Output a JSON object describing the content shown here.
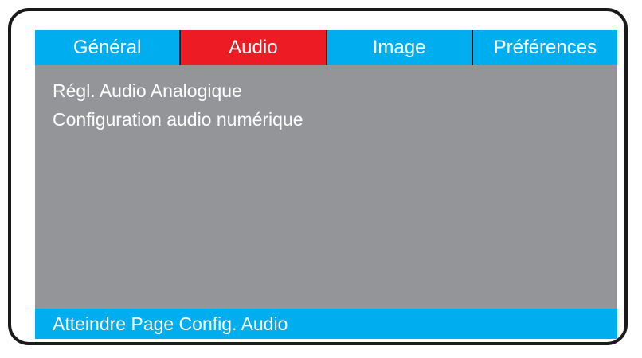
{
  "colors": {
    "tab_default": "#00aeef",
    "tab_active": "#ed1c24",
    "panel": "#939598",
    "status_bar": "#00aeef",
    "text": "#ffffff",
    "frame_border": "#1a1a1a"
  },
  "tabs": [
    {
      "label": "Général",
      "active": false
    },
    {
      "label": "Audio",
      "active": true
    },
    {
      "label": "Image",
      "active": false
    },
    {
      "label": "Préférences",
      "active": false
    }
  ],
  "menu": {
    "items": [
      {
        "label": "Régl. Audio Analogique"
      },
      {
        "label": "Configuration audio numérique"
      }
    ]
  },
  "status_bar": {
    "text": "Atteindre Page Config. Audio"
  }
}
